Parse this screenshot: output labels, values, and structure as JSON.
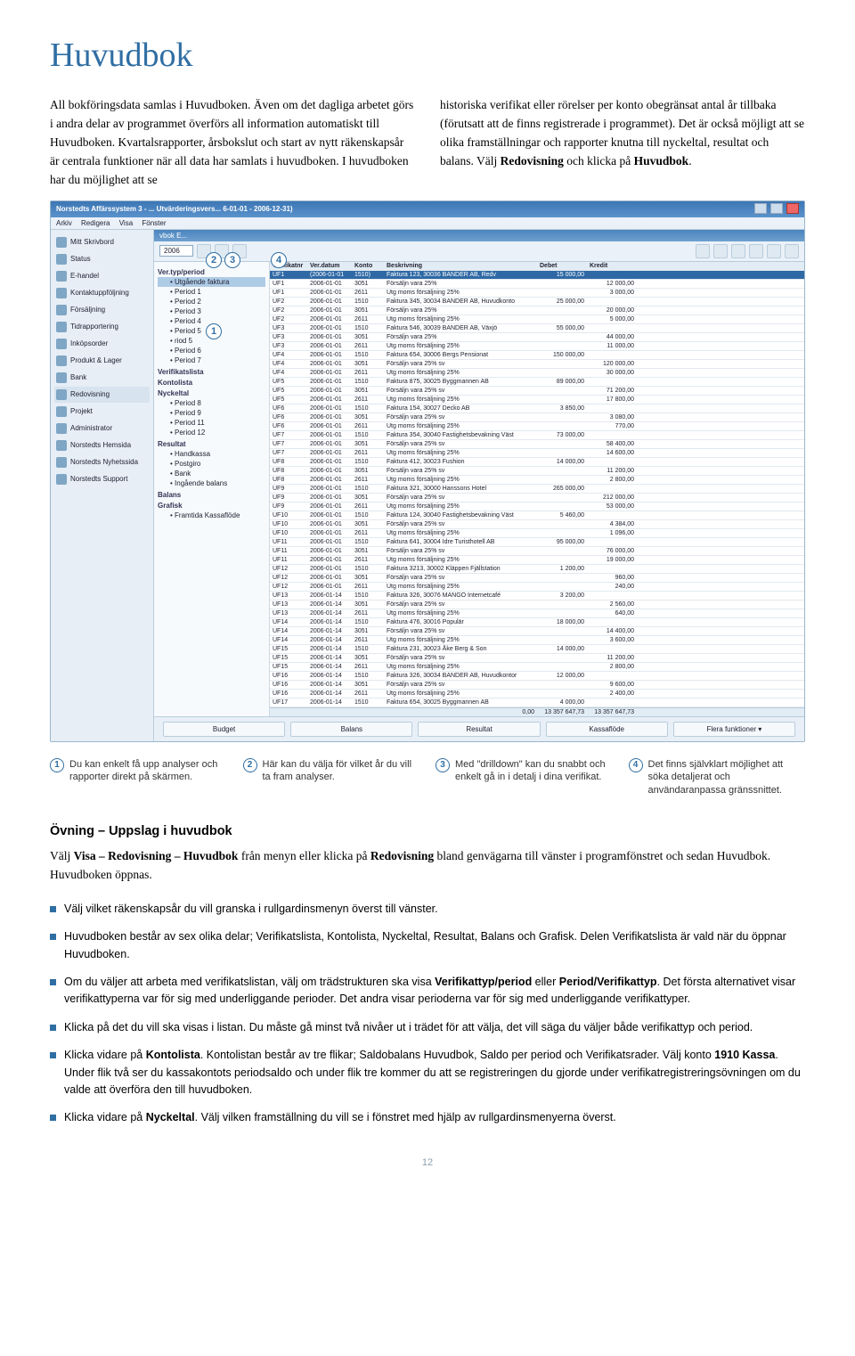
{
  "title": "Huvudbok",
  "intro_col1": "All bokföringsdata samlas i Huvudboken. Även om det dagliga arbetet görs i andra delar av programmet överförs all information automatiskt till Huvudboken. Kvartalsrapporter, årsbokslut och start av nytt räkenskapsår är centrala funktioner när all data har samlats i huvudboken. I huvudboken har du möjlighet att se",
  "intro_col2_a": "historiska verifikat eller rörelser per konto obegränsat antal år tillbaka (förutsatt att de finns registrerade i programmet). Det är också möjligt att se olika framställningar och rapporter knutna till nyckeltal, resultat och balans. Välj ",
  "intro_col2_b": "Redovisning",
  "intro_col2_c": " och klicka på ",
  "intro_col2_d": "Huvudbok",
  "intro_col2_e": ".",
  "app": {
    "title": "Norstedts Affärssystem 3 - ... Utvärderingsvers... 6-01-01 - 2006-12-31)",
    "menu": [
      "Arkiv",
      "Redigera",
      "Visa",
      "Fönster"
    ],
    "inner_title": "vbok E...",
    "year": "2006",
    "sidebar": [
      "Mitt Skrivbord",
      "Status",
      "E-handel",
      "Kontaktuppföljning",
      "Försäljning",
      "Tidrapportering",
      "Inköpsorder",
      "Produkt & Lager",
      "Bank",
      "Redovisning",
      "Projekt",
      "Administrator",
      "Norstedts Hemsida",
      "Norstedts Nyhetssida",
      "Norstedts Support"
    ],
    "sidebar_selected": 9,
    "tree": {
      "sections": [
        {
          "head": "Ver.typ/period",
          "items": [
            "Utgående faktura",
            "Period 1",
            "Period 2",
            "Period 3",
            "Period 4",
            "Period 5",
            "riod 5",
            "Period 6",
            "Period 7"
          ]
        },
        {
          "head": "Verifikatslista",
          "items": []
        },
        {
          "head": "Kontolista",
          "items": []
        },
        {
          "head": "Nyckeltal",
          "items": [
            "Period 8",
            "Period 9",
            "Period 11",
            "Period 12"
          ]
        },
        {
          "head": "Resultat",
          "items": [
            "Handkassa",
            "Postgiro",
            "Bank",
            "Ingående balans"
          ]
        },
        {
          "head": "Balans",
          "items": []
        },
        {
          "head": "Grafisk",
          "items": []
        },
        {
          "head": "",
          "items": [
            "Framtida Kassaflöde"
          ]
        }
      ],
      "selected": "Utgående faktura"
    },
    "grid": {
      "columns": [
        "Verifikatnr",
        "Ver.datum",
        "Konto",
        "Beskrivning",
        "Debet",
        "Kredit"
      ],
      "rows": [
        [
          "UF1",
          "(2006-01-01",
          "1510)",
          "Faktura 123, 30036 BANDER AB, Redv",
          "15 000,00",
          ""
        ],
        [
          "UF1",
          "2006-01-01",
          "3051",
          "Försäljn vara 25%",
          "",
          "12 000,00"
        ],
        [
          "UF1",
          "2006-01-01",
          "2611",
          "Utg moms försäljning 25%",
          "",
          "3 000,00"
        ],
        [
          "UF2",
          "2006-01-01",
          "1510",
          "Faktura 345, 30034 BANDER AB, Huvudkonto",
          "25 000,00",
          ""
        ],
        [
          "UF2",
          "2006-01-01",
          "3051",
          "Försäljn vara 25%",
          "",
          "20 000,00"
        ],
        [
          "UF2",
          "2006-01-01",
          "2611",
          "Utg moms försäljning 25%",
          "",
          "5 000,00"
        ],
        [
          "UF3",
          "2006-01-01",
          "1510",
          "Faktura 546, 30039 BANDER AB, Växjö",
          "55 000,00",
          ""
        ],
        [
          "UF3",
          "2006-01-01",
          "3051",
          "Försäljn vara 25%",
          "",
          "44 000,00"
        ],
        [
          "UF3",
          "2006-01-01",
          "2611",
          "Utg moms försäljning 25%",
          "",
          "11 000,00"
        ],
        [
          "UF4",
          "2006-01-01",
          "1510",
          "Faktura 654, 30006 Bergs Pensionat",
          "150 000,00",
          ""
        ],
        [
          "UF4",
          "2006-01-01",
          "3051",
          "Försäljn vara 25% sv",
          "",
          "120 000,00"
        ],
        [
          "UF4",
          "2006-01-01",
          "2611",
          "Utg moms försäljning 25%",
          "",
          "30 000,00"
        ],
        [
          "UF5",
          "2006-01-01",
          "1510",
          "Faktura 875, 30025 Byggmannen AB",
          "89 000,00",
          ""
        ],
        [
          "UF5",
          "2006-01-01",
          "3051",
          "Försäljn vara 25% sv",
          "",
          "71 200,00"
        ],
        [
          "UF5",
          "2006-01-01",
          "2611",
          "Utg moms försäljning 25%",
          "",
          "17 800,00"
        ],
        [
          "UF6",
          "2006-01-01",
          "1510",
          "Faktura 154, 30027 Decko AB",
          "3 850,00",
          ""
        ],
        [
          "UF6",
          "2006-01-01",
          "3051",
          "Försäljn vara 25% sv",
          "",
          "3 080,00"
        ],
        [
          "UF6",
          "2006-01-01",
          "2611",
          "Utg moms försäljning 25%",
          "",
          "770,00"
        ],
        [
          "UF7",
          "2006-01-01",
          "1510",
          "Faktura 354, 30040 Fastighetsbevakning Väst",
          "73 000,00",
          ""
        ],
        [
          "UF7",
          "2006-01-01",
          "3051",
          "Försäljn vara 25% sv",
          "",
          "58 400,00"
        ],
        [
          "UF7",
          "2006-01-01",
          "2611",
          "Utg moms försäljning 25%",
          "",
          "14 600,00"
        ],
        [
          "UF8",
          "2006-01-01",
          "1510",
          "Faktura 412, 30023 Fushion",
          "14 000,00",
          ""
        ],
        [
          "UF8",
          "2006-01-01",
          "3051",
          "Försäljn vara 25% sv",
          "",
          "11 200,00"
        ],
        [
          "UF8",
          "2006-01-01",
          "2611",
          "Utg moms försäljning 25%",
          "",
          "2 800,00"
        ],
        [
          "UF9",
          "2006-01-01",
          "1510",
          "Faktura 321, 30000 Hanssons Hotel",
          "265 000,00",
          ""
        ],
        [
          "UF9",
          "2006-01-01",
          "3051",
          "Försäljn vara 25% sv",
          "",
          "212 000,00"
        ],
        [
          "UF9",
          "2006-01-01",
          "2611",
          "Utg moms försäljning 25%",
          "",
          "53 000,00"
        ],
        [
          "UF10",
          "2006-01-01",
          "1510",
          "Faktura 124, 30040 Fastighetsbevakning Väst",
          "5 460,00",
          ""
        ],
        [
          "UF10",
          "2006-01-01",
          "3051",
          "Försäljn vara 25% sv",
          "",
          "4 384,00"
        ],
        [
          "UF10",
          "2006-01-01",
          "2611",
          "Utg moms försäljning 25%",
          "",
          "1 096,00"
        ],
        [
          "UF11",
          "2006-01-01",
          "1510",
          "Faktura 641, 30004 Idre Turisthotell AB",
          "95 000,00",
          ""
        ],
        [
          "UF11",
          "2006-01-01",
          "3051",
          "Försäljn vara 25% sv",
          "",
          "76 000,00"
        ],
        [
          "UF11",
          "2006-01-01",
          "2611",
          "Utg moms försäljning 25%",
          "",
          "19 000,00"
        ],
        [
          "UF12",
          "2006-01-01",
          "1510",
          "Faktura 3213, 30002 Kläppen Fjällstation",
          "1 200,00",
          ""
        ],
        [
          "UF12",
          "2006-01-01",
          "3051",
          "Försäljn vara 25% sv",
          "",
          "960,00"
        ],
        [
          "UF12",
          "2006-01-01",
          "2611",
          "Utg moms försäljning 25%",
          "",
          "240,00"
        ],
        [
          "UF13",
          "2006-01-14",
          "1510",
          "Faktura 326, 30076 MANGO Internetcafé",
          "3 200,00",
          ""
        ],
        [
          "UF13",
          "2006-01-14",
          "3051",
          "Försäljn vara 25% sv",
          "",
          "2 560,00"
        ],
        [
          "UF13",
          "2006-01-14",
          "2611",
          "Utg moms försäljning 25%",
          "",
          "640,00"
        ],
        [
          "UF14",
          "2006-01-14",
          "1510",
          "Faktura 476, 30016 Populär",
          "18 000,00",
          ""
        ],
        [
          "UF14",
          "2006-01-14",
          "3051",
          "Försäljn vara 25% sv",
          "",
          "14 400,00"
        ],
        [
          "UF14",
          "2006-01-14",
          "2611",
          "Utg moms försäljning 25%",
          "",
          "3 600,00"
        ],
        [
          "UF15",
          "2006-01-14",
          "1510",
          "Faktura 231, 30023 Åke Berg & Son",
          "14 000,00",
          ""
        ],
        [
          "UF15",
          "2006-01-14",
          "3051",
          "Försäljn vara 25% sv",
          "",
          "11 200,00"
        ],
        [
          "UF15",
          "2006-01-14",
          "2611",
          "Utg moms försäljning 25%",
          "",
          "2 800,00"
        ],
        [
          "UF16",
          "2006-01-14",
          "1510",
          "Faktura 326, 30034 BANDER AB, Huvudkontor",
          "12 000,00",
          ""
        ],
        [
          "UF16",
          "2006-01-14",
          "3051",
          "Försäljn vara 25% sv",
          "",
          "9 600,00"
        ],
        [
          "UF16",
          "2006-01-14",
          "2611",
          "Utg moms försäljning 25%",
          "",
          "2 400,00"
        ],
        [
          "UF17",
          "2006-01-14",
          "1510",
          "Faktura 654, 30025 Byggmannen AB",
          "4 000,00",
          ""
        ]
      ],
      "totals": {
        "left": "0,00",
        "debet": "13 357 647,73",
        "kredit": "13 357 647,73"
      }
    },
    "bottom_tabs": [
      "Budget",
      "Balans",
      "Resultat",
      "Kassaflöde",
      "Flera funktioner ▾"
    ]
  },
  "callouts": {
    "c1": "1",
    "c2": "2",
    "c3": "3",
    "c4": "4"
  },
  "captions": [
    {
      "n": "1",
      "text": "Du kan enkelt få upp analyser och rapporter direkt på skärmen."
    },
    {
      "n": "2",
      "text": "Här kan du välja för vilket år du vill ta fram analyser."
    },
    {
      "n": "3",
      "text": "Med \"drilldown\" kan du snabbt och enkelt gå in i detalj i dina verifikat."
    },
    {
      "n": "4",
      "text": "Det finns självklart möjlighet att söka detaljerat och användaranpassa gränssnittet."
    }
  ],
  "exercise": {
    "heading": "Övning – Uppslag i huvudbok",
    "lead_a": "Välj ",
    "lead_b": "Visa – Redovisning – Huvudbok",
    "lead_c": " från menyn eller klicka på ",
    "lead_d": "Redovisning",
    "lead_e": " bland genvägarna till vänster i programfönstret och sedan Huvudbok. Huvudboken öppnas.",
    "bullets": [
      "Välj vilket räkenskapsår du vill granska i rullgardinsmenyn överst till vänster.",
      "Huvudboken består av sex olika delar; Verifikatslista, Kontolista, Nyckeltal, Resultat, Balans och Grafisk. Delen Verifikatslista är vald när du öppnar Huvudboken.",
      "Om du väljer att arbeta med verifikatslistan, välj om trädstrukturen ska visa <b>Verifikattyp/period</b> eller <b>Period/Verifikattyp</b>. Det första alternativet visar verifikattyperna var för sig med underliggande perioder. Det andra visar perioderna var för sig med underliggande verifikattyper.",
      "Klicka på det du vill ska visas i listan. Du måste gå minst två nivåer ut i trädet för att välja, det vill säga du väljer både verifikattyp och period.",
      "Klicka vidare på <b>Kontolista</b>. Kontolistan består av tre flikar; Saldobalans Huvudbok, Saldo per period och Verifikatsrader. Välj konto <b>1910 Kassa</b>. Under flik två ser du kassakontots periodsaldo och under flik tre kommer du att se registreringen du gjorde under verifikatregistreringsövningen om du valde att överföra den till huvudboken.",
      "Klicka vidare på <b>Nyckeltal</b>. Välj vilken framställning du vill se i fönstret med hjälp av rullgardinsmenyerna överst."
    ]
  },
  "page_number": "12"
}
